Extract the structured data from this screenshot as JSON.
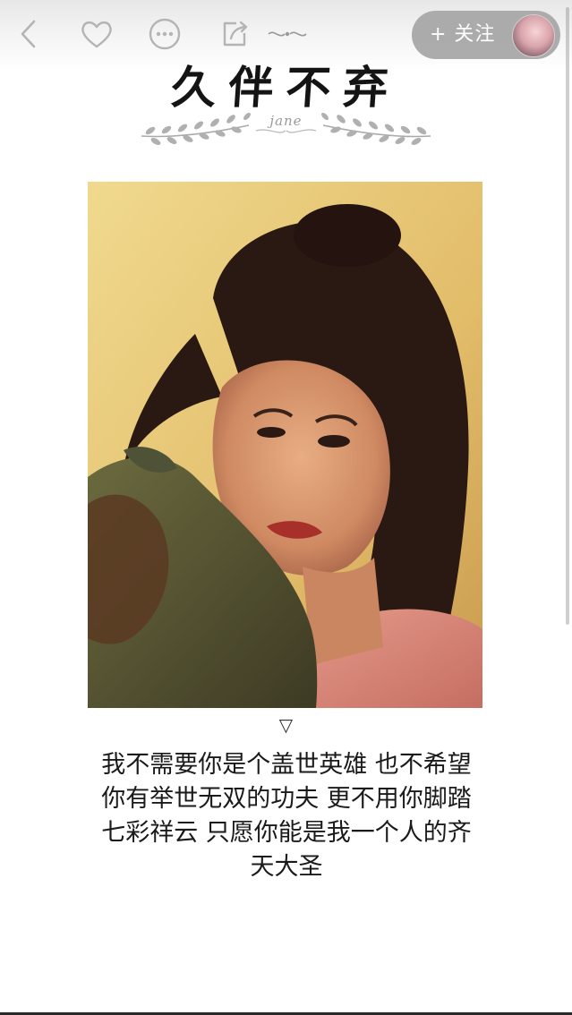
{
  "header": {
    "follow_label": "+ 关注",
    "icons": [
      "back-icon",
      "heart-icon",
      "more-icon",
      "share-icon",
      "ornament-icon"
    ]
  },
  "article": {
    "title": "久伴不弃",
    "ornament_text": "jane",
    "pointer": "▽",
    "poem_lines": [
      "我不需要你是个盖世英雄  也不希望",
      "你有举世无双的功夫  更不用你脚踏",
      "七彩祥云  只愿你能是我一个人的齐",
      "天大圣"
    ]
  },
  "colors": {
    "accent_pill": "#a8a8a8",
    "icon_gray": "#b4b4b4",
    "text": "#1a1a1a"
  }
}
